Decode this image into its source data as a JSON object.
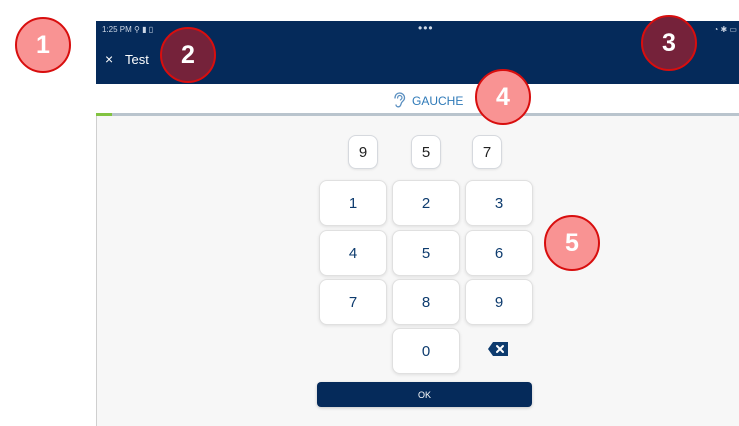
{
  "status_bar": {
    "time": "1:25 PM ⚲ ▮ ▯",
    "dots": "•••",
    "icons": "◔ ✱ ▭"
  },
  "header": {
    "close_icon": "×",
    "title": "Test"
  },
  "ear": {
    "label": "GAUCHE",
    "icon": "ear-icon"
  },
  "progress": {
    "fraction": 0.025,
    "fill_color": "#82c341"
  },
  "sequence": [
    "9",
    "5",
    "7"
  ],
  "keypad": {
    "keys": [
      "1",
      "2",
      "3",
      "4",
      "5",
      "6",
      "7",
      "8",
      "9",
      "0"
    ],
    "backspace_icon": "backspace-icon",
    "ok_label": "OK"
  },
  "annotations": [
    "1",
    "2",
    "3",
    "4",
    "5"
  ],
  "colors": {
    "header_bg": "#052a5a",
    "badge_light": "#f99393",
    "badge_dark": "#75223a",
    "badge_border": "#d80e0e"
  }
}
